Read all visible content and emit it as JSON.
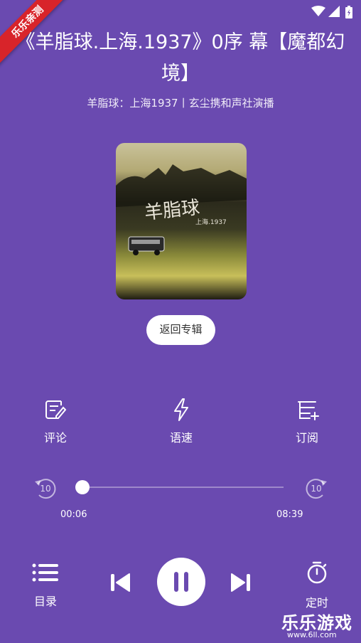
{
  "ribbon_label": "乐乐亲测",
  "episode_title": "《羊脂球.上海.1937》0序 幕【魔都幻境】",
  "album_info": "羊脂球：上海1937丨玄尘携和声社演播",
  "cover": {
    "title_text": "羊脂球",
    "sub_text": "上海.1937"
  },
  "back_album_label": "返回专辑",
  "tools": {
    "comment_label": "评论",
    "speed_label": "语速",
    "subscribe_label": "订阅"
  },
  "player": {
    "rewind_seconds": "10",
    "forward_seconds": "10",
    "current_time": "00:06",
    "total_time": "08:39",
    "progress_fraction": 0.0116
  },
  "bottom": {
    "catalog_label": "目录",
    "timer_label": "定时"
  },
  "watermark": {
    "brand": "乐乐游戏",
    "url": "www.6ll.com"
  },
  "colors": {
    "background": "#6a4ab0",
    "ribbon": "#d8242a",
    "accent_icon": "#6a4ab0"
  }
}
